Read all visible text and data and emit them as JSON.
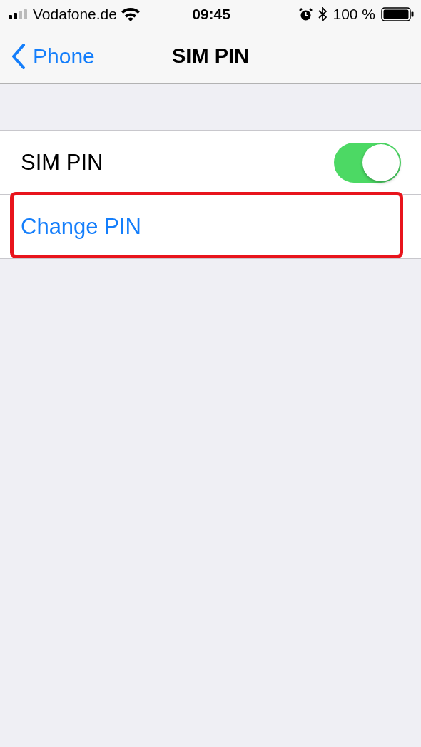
{
  "status_bar": {
    "carrier": "Vodafone.de",
    "time": "09:45",
    "battery": "100 %"
  },
  "nav": {
    "back": "Phone",
    "title": "SIM PIN"
  },
  "rows": [
    {
      "kind": "toggle",
      "label": "SIM PIN",
      "on": true,
      "highlighted": false
    },
    {
      "kind": "action",
      "label": "Change PIN",
      "highlighted": true
    }
  ]
}
